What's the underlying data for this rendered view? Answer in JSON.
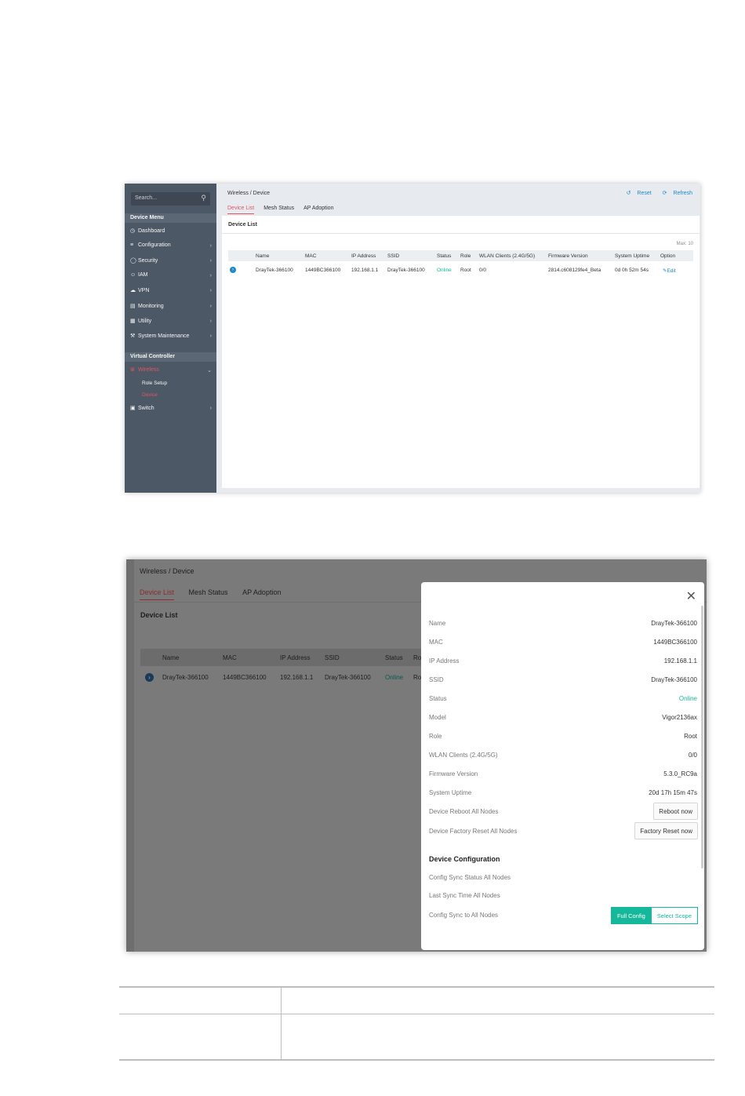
{
  "shot1": {
    "sidebar": {
      "search_placeholder": "Search...",
      "device_menu_heading": "Device Menu",
      "items": [
        {
          "label": "Dashboard"
        },
        {
          "label": "Configuration"
        },
        {
          "label": "Security"
        },
        {
          "label": "IAM"
        },
        {
          "label": "VPN"
        },
        {
          "label": "Monitoring"
        },
        {
          "label": "Utility"
        },
        {
          "label": "System Maintenance"
        }
      ],
      "virtual_controller_heading": "Virtual Controller",
      "wireless_label": "Wireless",
      "sub_items": [
        {
          "label": "Role Setup"
        },
        {
          "label": "Device"
        }
      ],
      "switch_label": "Switch"
    },
    "breadcrumb": "Wireless / Device",
    "reset_label": "Reset",
    "refresh_label": "Refresh",
    "tabs": [
      {
        "label": "Device List"
      },
      {
        "label": "Mesh Status"
      },
      {
        "label": "AP Adoption"
      }
    ],
    "panel_title": "Device List",
    "max_label": "Max: 10",
    "columns": [
      "Name",
      "MAC",
      "IP Address",
      "SSID",
      "Status",
      "Role",
      "WLAN Clients (2.4G/5G)",
      "Firmware Version",
      "System Uptime",
      "Option"
    ],
    "row": {
      "name": "DrayTek-366100",
      "mac": "1449BC366100",
      "ip": "192.168.1.1",
      "ssid": "DrayTek-366100",
      "status": "Online",
      "role": "Root",
      "clients": "0/0",
      "firmware": "2814.c608129fe4_Beta",
      "uptime": "0d 0h 52m 54s",
      "option": "Edit"
    }
  },
  "shot2": {
    "breadcrumb": "Wireless / Device",
    "tabs": [
      {
        "label": "Device List"
      },
      {
        "label": "Mesh Status"
      },
      {
        "label": "AP Adoption"
      }
    ],
    "panel_title": "Device List",
    "columns": [
      "Name",
      "MAC",
      "IP Address",
      "SSID",
      "Status",
      "Ro"
    ],
    "row": {
      "name": "DrayTek-366100",
      "mac": "1449BC366100",
      "ip": "192.168.1.1",
      "ssid": "DrayTek-366100",
      "status": "Online",
      "role": "Ro"
    },
    "modal": {
      "fields": [
        {
          "key": "Name",
          "value": "DrayTek-366100"
        },
        {
          "key": "MAC",
          "value": "1449BC366100"
        },
        {
          "key": "IP Address",
          "value": "192.168.1.1"
        },
        {
          "key": "SSID",
          "value": "DrayTek-366100"
        },
        {
          "key": "Status",
          "value": "Online"
        },
        {
          "key": "Model",
          "value": "Vigor2136ax"
        },
        {
          "key": "Role",
          "value": "Root"
        },
        {
          "key": "WLAN Clients (2.4G/5G)",
          "value": "0/0"
        },
        {
          "key": "Firmware Version",
          "value": "5.3.0_RC9a"
        },
        {
          "key": "System Uptime",
          "value": "20d 17h 15m 47s"
        }
      ],
      "reboot_label": "Device Reboot All Nodes",
      "reboot_button": "Reboot now",
      "factory_label": "Device Factory Reset All Nodes",
      "factory_button": "Factory Reset now",
      "config_title": "Device Configuration",
      "sync_status_label": "Config Sync Status All Nodes",
      "last_sync_label": "Last Sync Time All Nodes",
      "sync_label": "Config Sync to All Nodes",
      "full_config_button": "Full Config",
      "select_scope_button": "Select Scope"
    }
  }
}
